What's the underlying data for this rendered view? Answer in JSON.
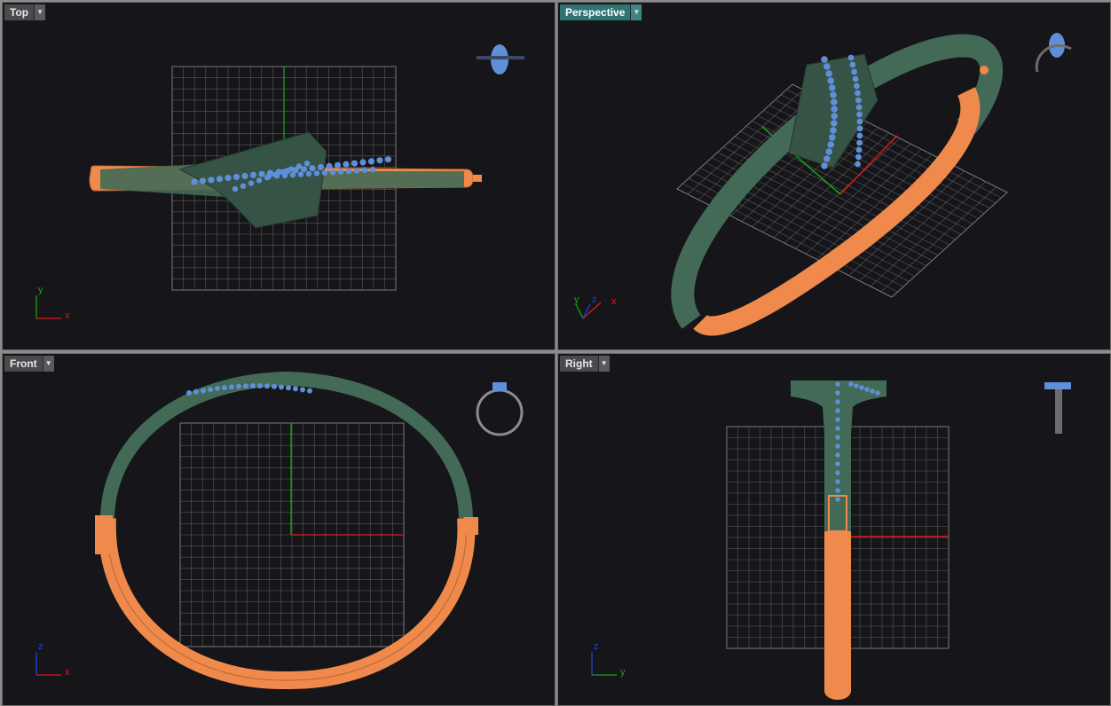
{
  "colors": {
    "background": "#16161a",
    "grid": "#7a7a7a",
    "axis_x": "#e01818",
    "axis_y": "#18a018",
    "axis_z": "#2040e0",
    "model_green": "#426a56",
    "model_orange": "#ef8a4c",
    "gem_blue": "#5f8fd8",
    "active_tab": "#2f7472"
  },
  "viewports": {
    "top": {
      "title": "Top",
      "dropdown_icon": "triangle-down-icon",
      "axis_h": "x",
      "axis_v": "y"
    },
    "perspective": {
      "title": "Perspective",
      "dropdown_icon": "triangle-down-icon",
      "axis_h": "x",
      "axis_v": "y",
      "axis_d": "z"
    },
    "front": {
      "title": "Front",
      "dropdown_icon": "triangle-down-icon",
      "axis_h": "x",
      "axis_v": "z"
    },
    "right": {
      "title": "Right",
      "dropdown_icon": "triangle-down-icon",
      "axis_h": "y",
      "axis_v": "z"
    }
  }
}
